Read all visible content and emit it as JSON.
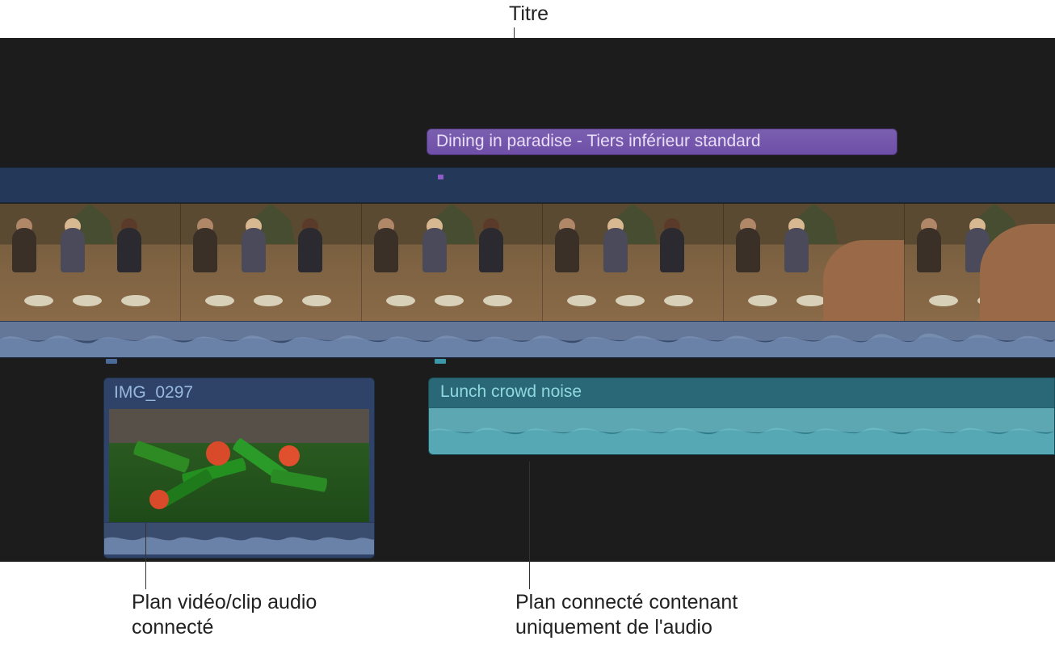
{
  "annotations": {
    "titre": "Titre",
    "connected_va": "Plan vidéo/clip audio connecté",
    "connected_audio": "Plan connecté contenant uniquement de l'audio"
  },
  "title_clip": {
    "label": "Dining in paradise - Tiers inférieur standard"
  },
  "connected_clip": {
    "label": "IMG_0297"
  },
  "audio_clip": {
    "label": "Lunch crowd noise"
  },
  "colors": {
    "title_purple": "#6f4fa8",
    "storyline_blue": "#3a4d6e",
    "audio_teal": "#2a6877",
    "bg_dark": "#1c1c1c"
  }
}
